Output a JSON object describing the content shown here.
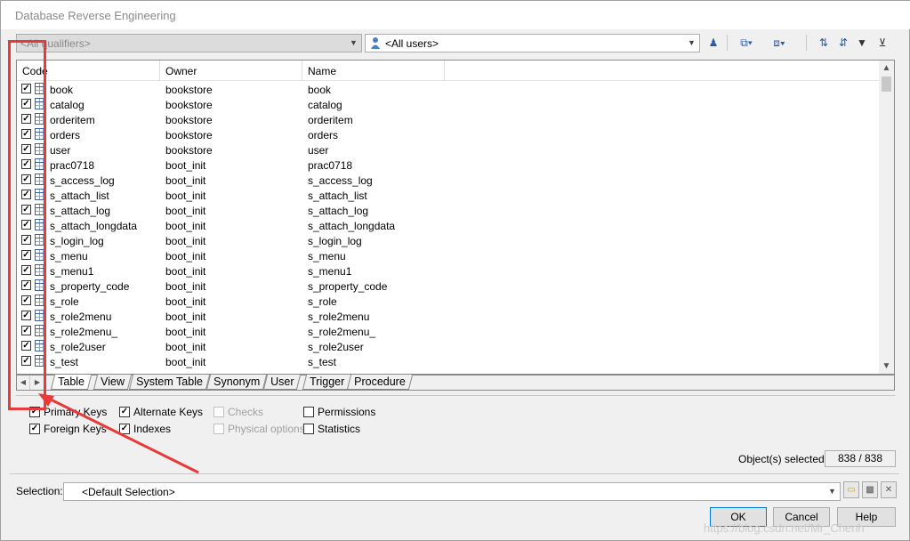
{
  "window": {
    "title": "Database Reverse Engineering"
  },
  "filters": {
    "qualifier": "<All qualifiers>",
    "user": "<All users>"
  },
  "toolbar": {
    "icons": [
      "user-filter-icon",
      "select-all-icon",
      "deselect-all-icon",
      "move-up-icon",
      "move-down-icon",
      "filter-icon",
      "clear-filter-icon"
    ]
  },
  "list": {
    "columns": [
      "Code",
      "Owner",
      "Name"
    ],
    "rows": [
      {
        "code": "book",
        "owner": "bookstore",
        "name": "book"
      },
      {
        "code": "catalog",
        "owner": "bookstore",
        "name": "catalog"
      },
      {
        "code": "orderitem",
        "owner": "bookstore",
        "name": "orderitem"
      },
      {
        "code": "orders",
        "owner": "bookstore",
        "name": "orders"
      },
      {
        "code": "user",
        "owner": "bookstore",
        "name": "user"
      },
      {
        "code": "prac0718",
        "owner": "boot_init",
        "name": "prac0718"
      },
      {
        "code": "s_access_log",
        "owner": "boot_init",
        "name": "s_access_log"
      },
      {
        "code": "s_attach_list",
        "owner": "boot_init",
        "name": "s_attach_list"
      },
      {
        "code": "s_attach_log",
        "owner": "boot_init",
        "name": "s_attach_log"
      },
      {
        "code": "s_attach_longdata",
        "owner": "boot_init",
        "name": "s_attach_longdata"
      },
      {
        "code": "s_login_log",
        "owner": "boot_init",
        "name": "s_login_log"
      },
      {
        "code": "s_menu",
        "owner": "boot_init",
        "name": "s_menu"
      },
      {
        "code": "s_menu1",
        "owner": "boot_init",
        "name": "s_menu1"
      },
      {
        "code": "s_property_code",
        "owner": "boot_init",
        "name": "s_property_code"
      },
      {
        "code": "s_role",
        "owner": "boot_init",
        "name": "s_role"
      },
      {
        "code": "s_role2menu",
        "owner": "boot_init",
        "name": "s_role2menu"
      },
      {
        "code": "s_role2menu_",
        "owner": "boot_init",
        "name": "s_role2menu_"
      },
      {
        "code": "s_role2user",
        "owner": "boot_init",
        "name": "s_role2user"
      },
      {
        "code": "s_test",
        "owner": "boot_init",
        "name": "s_test"
      }
    ]
  },
  "tabs": [
    "Table",
    "View",
    "System Table",
    "Synonym",
    "User",
    "Trigger",
    "Procedure"
  ],
  "active_tab": "Table",
  "options": [
    {
      "label": "Primary Keys",
      "checked": true,
      "enabled": true
    },
    {
      "label": "Alternate Keys",
      "checked": true,
      "enabled": true
    },
    {
      "label": "Checks",
      "checked": false,
      "enabled": false
    },
    {
      "label": "Permissions",
      "checked": false,
      "enabled": true
    },
    {
      "label": "Foreign Keys",
      "checked": true,
      "enabled": true
    },
    {
      "label": "Indexes",
      "checked": true,
      "enabled": true
    },
    {
      "label": "Physical options",
      "checked": false,
      "enabled": false
    },
    {
      "label": "Statistics",
      "checked": false,
      "enabled": true
    }
  ],
  "status": {
    "selected_label": "Object(s) selected:",
    "selected_value": "838 / 838"
  },
  "selection": {
    "label": "Selection:",
    "value": "<Default Selection>"
  },
  "buttons": {
    "ok": "OK",
    "cancel": "Cancel",
    "help": "Help"
  },
  "watermark": "https://blog.csdn.net/Mr_Chenh",
  "colors": {
    "highlight": "#e83a3a",
    "ok_border": "#0078d7"
  }
}
